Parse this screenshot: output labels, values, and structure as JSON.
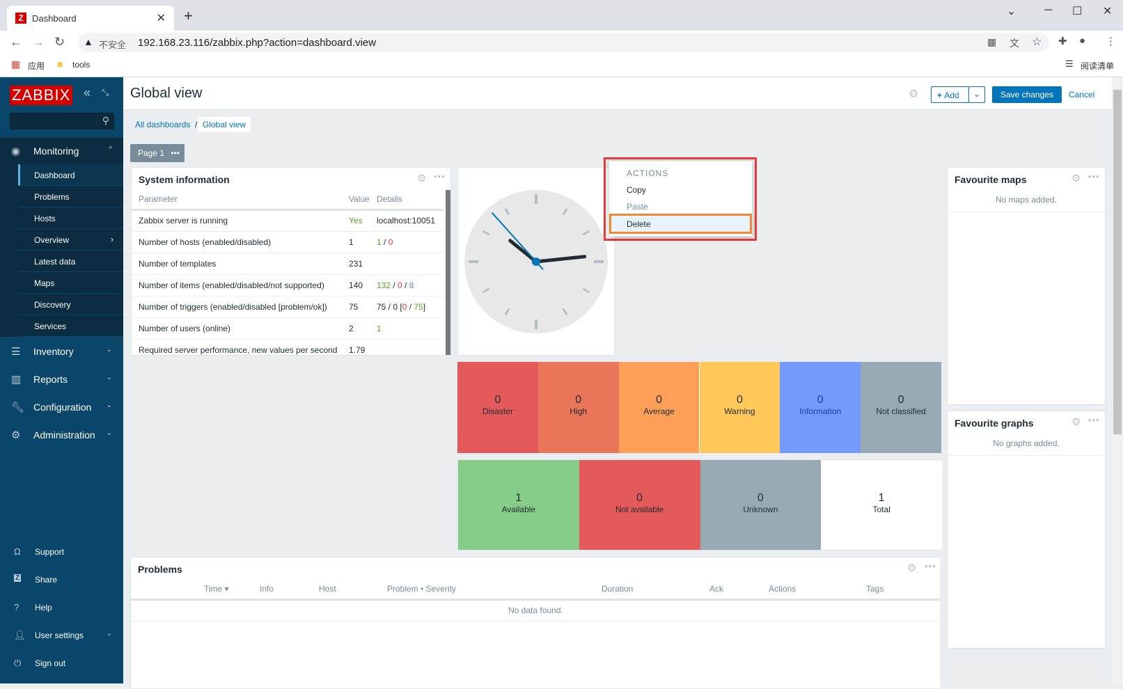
{
  "browser": {
    "tab_title": "Dashboard",
    "favicon": "Z",
    "security": "不安全",
    "url": "192.168.23.116/zabbix.php?action=dashboard.view",
    "bookmarks": [
      "应用",
      "tools"
    ],
    "reading_list": "阅读清单"
  },
  "sidebar": {
    "logo": "ZABBIX",
    "sections": [
      {
        "label": "Monitoring",
        "icon": "eye-icon",
        "expanded": true
      },
      {
        "label": "Inventory",
        "icon": "list-icon"
      },
      {
        "label": "Reports",
        "icon": "bar-chart-icon"
      },
      {
        "label": "Configuration",
        "icon": "wrench-icon"
      },
      {
        "label": "Administration",
        "icon": "gear-icon"
      }
    ],
    "monitoring_items": [
      "Dashboard",
      "Problems",
      "Hosts",
      "Overview",
      "Latest data",
      "Maps",
      "Discovery",
      "Services"
    ],
    "footer": [
      {
        "label": "Support",
        "icon": "headset-icon"
      },
      {
        "label": "Share",
        "icon": "z-icon"
      },
      {
        "label": "Help",
        "icon": "help-icon"
      },
      {
        "label": "User settings",
        "icon": "user-icon"
      },
      {
        "label": "Sign out",
        "icon": "power-icon"
      }
    ]
  },
  "header": {
    "title": "Global view",
    "add_label": "Add",
    "save_label": "Save changes",
    "cancel_label": "Cancel"
  },
  "breadcrumb": [
    "All dashboards",
    "Global view"
  ],
  "page_tab": "Page 1",
  "system_info": {
    "title": "System information",
    "columns": [
      "Parameter",
      "Value",
      "Details"
    ],
    "rows": [
      {
        "p": "Zabbix server is running",
        "v": "Yes",
        "d": [
          [
            "localhost:10051",
            ""
          ]
        ]
      },
      {
        "p": "Number of hosts (enabled/disabled)",
        "v": "1",
        "d": [
          [
            "1",
            "g"
          ],
          [
            " / ",
            ""
          ],
          [
            "0",
            "r"
          ]
        ]
      },
      {
        "p": "Number of templates",
        "v": "231",
        "d": []
      },
      {
        "p": "Number of items (enabled/disabled/not supported)",
        "v": "140",
        "d": [
          [
            "132",
            "g"
          ],
          [
            " / ",
            ""
          ],
          [
            "0",
            "r"
          ],
          [
            " / ",
            ""
          ],
          [
            "8",
            "gr"
          ]
        ]
      },
      {
        "p": "Number of triggers (enabled/disabled [problem/ok])",
        "v": "75",
        "d": [
          [
            "75 / 0 [",
            ""
          ],
          [
            "0",
            "r"
          ],
          [
            " / ",
            ""
          ],
          [
            "75",
            "g"
          ],
          [
            "]",
            ""
          ]
        ]
      },
      {
        "p": "Number of users (online)",
        "v": "2",
        "d": [
          [
            "1",
            "g"
          ]
        ]
      },
      {
        "p": "Required server performance, new values per second",
        "v": "1.79",
        "d": []
      }
    ]
  },
  "clock": {
    "hour": 2.8,
    "minute": 51.5,
    "second": 53
  },
  "context_menu": {
    "header": "ACTIONS",
    "items": [
      "Copy",
      "Paste",
      "Delete"
    ],
    "highlighted": "Delete"
  },
  "severity": [
    {
      "label": "Disaster",
      "count": "0",
      "color": "#e45959"
    },
    {
      "label": "High",
      "count": "0",
      "color": "#e97659"
    },
    {
      "label": "Average",
      "count": "0",
      "color": "#ffa059"
    },
    {
      "label": "Warning",
      "count": "0",
      "color": "#ffc859"
    },
    {
      "label": "Information",
      "count": "0",
      "color": "#7499ff"
    },
    {
      "label": "Not classified",
      "count": "0",
      "color": "#97aab3"
    }
  ],
  "host_availability": [
    {
      "label": "Available",
      "count": "1",
      "color": "#86cc89"
    },
    {
      "label": "Not available",
      "count": "0",
      "color": "#e45959"
    },
    {
      "label": "Unknown",
      "count": "0",
      "color": "#97aab3"
    },
    {
      "label": "Total",
      "count": "1",
      "color": "#ffffff"
    }
  ],
  "fav_maps": {
    "title": "Favourite maps",
    "empty": "No maps added."
  },
  "fav_graphs": {
    "title": "Favourite graphs",
    "empty": "No graphs added."
  },
  "problems": {
    "title": "Problems",
    "columns": [
      "Time ▾",
      "Info",
      "Host",
      "Problem • Severity",
      "Duration",
      "Ack",
      "Actions",
      "Tags"
    ],
    "empty": "No data found."
  }
}
